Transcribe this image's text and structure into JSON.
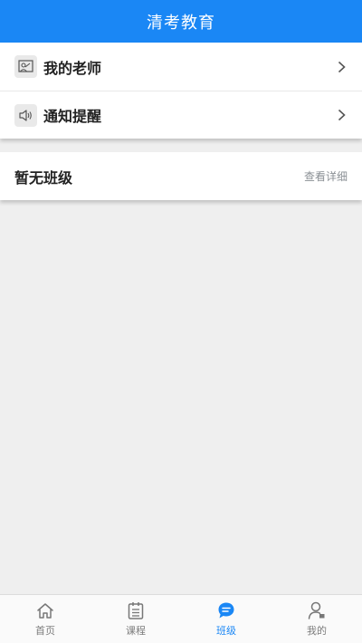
{
  "header": {
    "title": "清考教育"
  },
  "menu": {
    "items": [
      {
        "label": "我的老师",
        "icon": "teacher-board-icon"
      },
      {
        "label": "通知提醒",
        "icon": "speaker-icon"
      }
    ]
  },
  "class_section": {
    "title": "暂无班级",
    "link": "查看详细"
  },
  "tabbar": {
    "active_color": "#1a87f5",
    "items": [
      {
        "label": "首页",
        "icon": "home-icon",
        "active": false
      },
      {
        "label": "课程",
        "icon": "course-list-icon",
        "active": false
      },
      {
        "label": "班级",
        "icon": "chat-bubble-icon",
        "active": true
      },
      {
        "label": "我的",
        "icon": "user-icon",
        "active": false
      }
    ]
  },
  "colors": {
    "header_bg": "#1a87f5",
    "page_bg": "#efefef",
    "card_bg": "#ffffff"
  }
}
